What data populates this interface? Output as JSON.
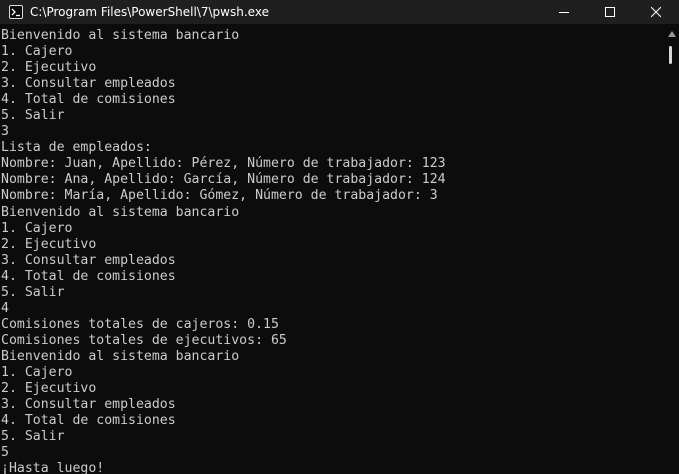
{
  "window": {
    "title": "C:\\Program Files\\PowerShell\\7\\pwsh.exe",
    "app_icon": "powershell-icon",
    "controls": [
      "minimize-icon",
      "maximize-icon",
      "close-icon"
    ]
  },
  "terminal": {
    "lines": [
      "Bienvenido al sistema bancario",
      "1. Cajero",
      "2. Ejecutivo",
      "3. Consultar empleados",
      "4. Total de comisiones",
      "5. Salir",
      "3",
      "Lista de empleados:",
      "Nombre: Juan, Apellido: Pérez, Número de trabajador: 123",
      "Nombre: Ana, Apellido: García, Número de trabajador: 124",
      "Nombre: María, Apellido: Gómez, Número de trabajador: 3",
      "Bienvenido al sistema bancario",
      "1. Cajero",
      "2. Ejecutivo",
      "3. Consultar empleados",
      "4. Total de comisiones",
      "5. Salir",
      "4",
      "Comisiones totales de cajeros: 0.15",
      "Comisiones totales de ejecutivos: 65",
      "Bienvenido al sistema bancario",
      "1. Cajero",
      "2. Ejecutivo",
      "3. Consultar empleados",
      "4. Total de comisiones",
      "5. Salir",
      "5",
      "¡Hasta luego!"
    ]
  },
  "colors": {
    "background": "#0c0c0c",
    "titlebar": "#1f1f1f",
    "text": "#cccccc"
  }
}
